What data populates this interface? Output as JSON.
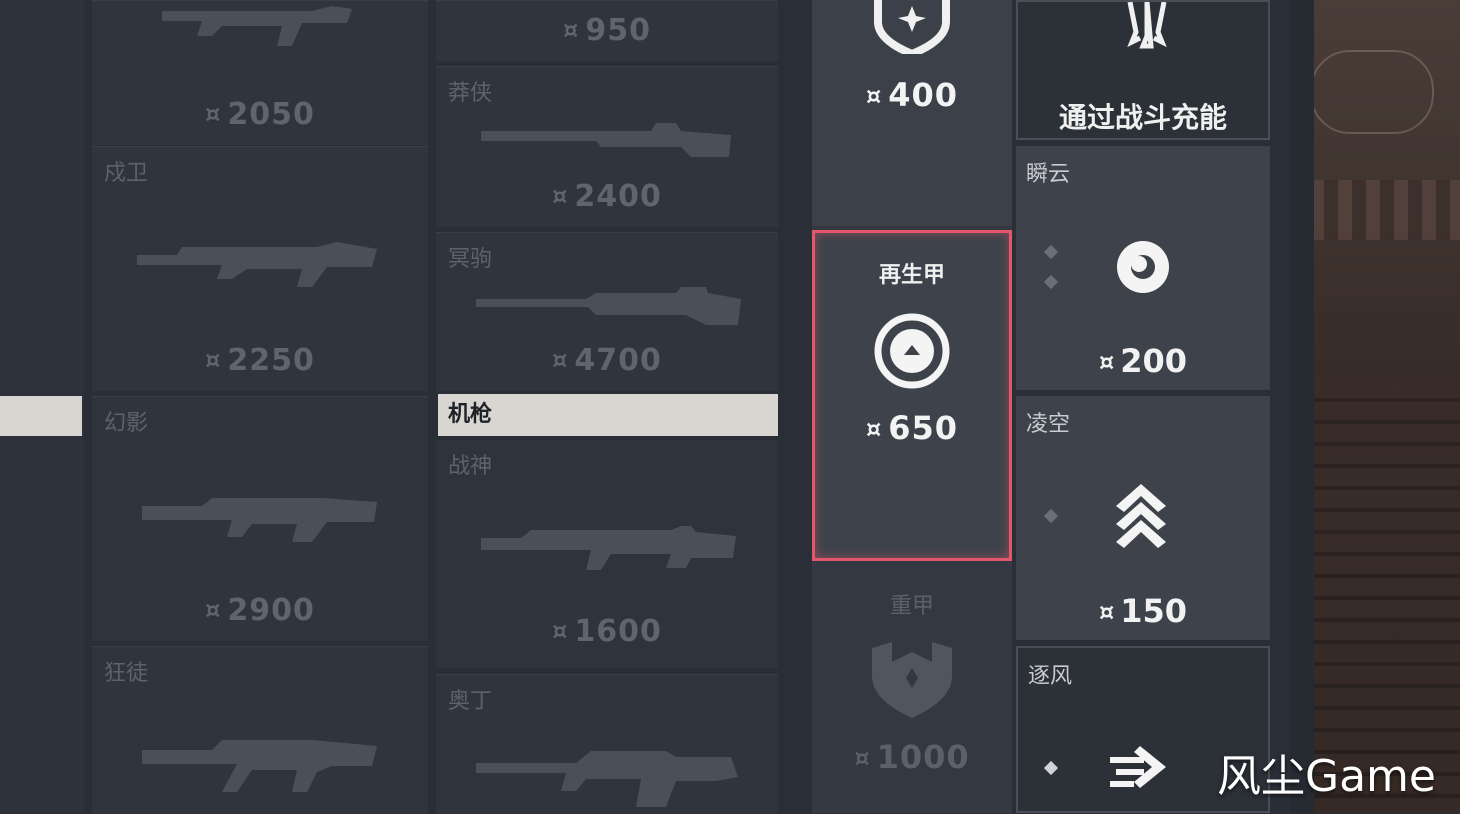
{
  "weapons_col1": [
    {
      "name": "",
      "price": "2050"
    },
    {
      "name": "戍卫",
      "price": "2250"
    },
    {
      "name": "幻影",
      "price": "2900"
    },
    {
      "name": "狂徒",
      "price": ""
    }
  ],
  "weapons_col2": [
    {
      "name": "",
      "price": "950"
    },
    {
      "name": "莽侠",
      "price": "2400"
    },
    {
      "name": "冥驹",
      "price": "4700"
    },
    {
      "name": "战神",
      "price": "1600"
    },
    {
      "name": "奥丁",
      "price": ""
    }
  ],
  "category_bar": "机枪",
  "shields": {
    "light": {
      "price": "400"
    },
    "regen": {
      "name": "再生甲",
      "price": "650"
    },
    "heavy": {
      "name": "重甲",
      "price": "1000"
    }
  },
  "abilities": {
    "ultimate_text": "通过战斗充能",
    "a1": {
      "name": "瞬云",
      "price": "200"
    },
    "a2": {
      "name": "凌空",
      "price": "150"
    },
    "a3": {
      "name": "逐风"
    }
  },
  "watermark": "风尘Game",
  "colors": {
    "selection": "#e4576a",
    "panel": "#3e434b",
    "category_bar": "#d9d6d2"
  }
}
